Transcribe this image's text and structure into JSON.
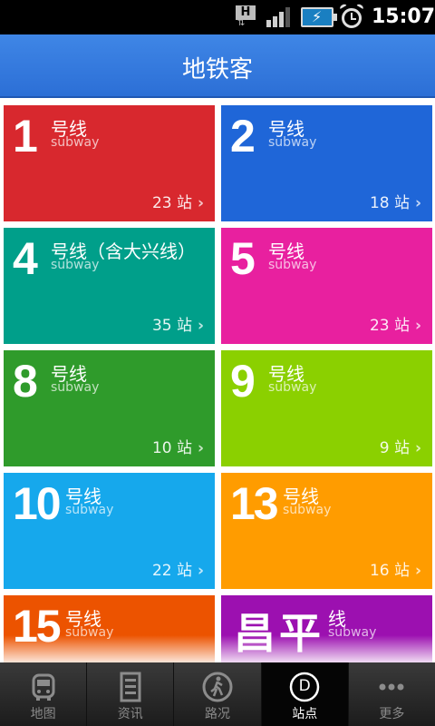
{
  "status_bar": {
    "network_letter": "H",
    "time": "15:07",
    "signal_bars": 3,
    "battery_state": "charging",
    "icons": [
      "network-h-icon",
      "signal-icon",
      "battery-charging-icon",
      "alarm-clock-icon"
    ]
  },
  "header": {
    "title": "地铁客"
  },
  "lines": [
    {
      "number": "1",
      "name": "号线",
      "sub": "subway",
      "count": "23 站",
      "color": "#d8282e"
    },
    {
      "number": "2",
      "name": "号线",
      "sub": "subway",
      "count": "18 站",
      "color": "#1f66d8"
    },
    {
      "number": "4",
      "name": "号线（含大兴线）",
      "sub": "subway",
      "count": "35 站",
      "color": "#009f8a"
    },
    {
      "number": "5",
      "name": "号线",
      "sub": "subway",
      "count": "23 站",
      "color": "#e8209f"
    },
    {
      "number": "8",
      "name": "号线",
      "sub": "subway",
      "count": "10 站",
      "color": "#2f9b2b"
    },
    {
      "number": "9",
      "name": "号线",
      "sub": "subway",
      "count": "9 站",
      "color": "#8bd000"
    },
    {
      "number": "10",
      "name": "号线",
      "sub": "subway",
      "count": "22 站",
      "color": "#16a8ec"
    },
    {
      "number": "13",
      "name": "号线",
      "sub": "subway",
      "count": "16 站",
      "color": "#ff9c00"
    },
    {
      "number": "15",
      "name": "号线",
      "sub": "subway",
      "count": "",
      "color": "#ec5300"
    },
    {
      "number": "昌平",
      "name": "线",
      "sub": "subway",
      "count": "",
      "color": "#9c10b0"
    }
  ],
  "nav": {
    "items": [
      {
        "label": "地图",
        "icon": "bus-icon"
      },
      {
        "label": "资讯",
        "icon": "news-document-icon"
      },
      {
        "label": "路况",
        "icon": "pedestrian-icon"
      },
      {
        "label": "站点",
        "icon": "station-d-icon",
        "active": true,
        "glyph": "D"
      },
      {
        "label": "更多",
        "icon": "more-dots-icon"
      }
    ]
  }
}
